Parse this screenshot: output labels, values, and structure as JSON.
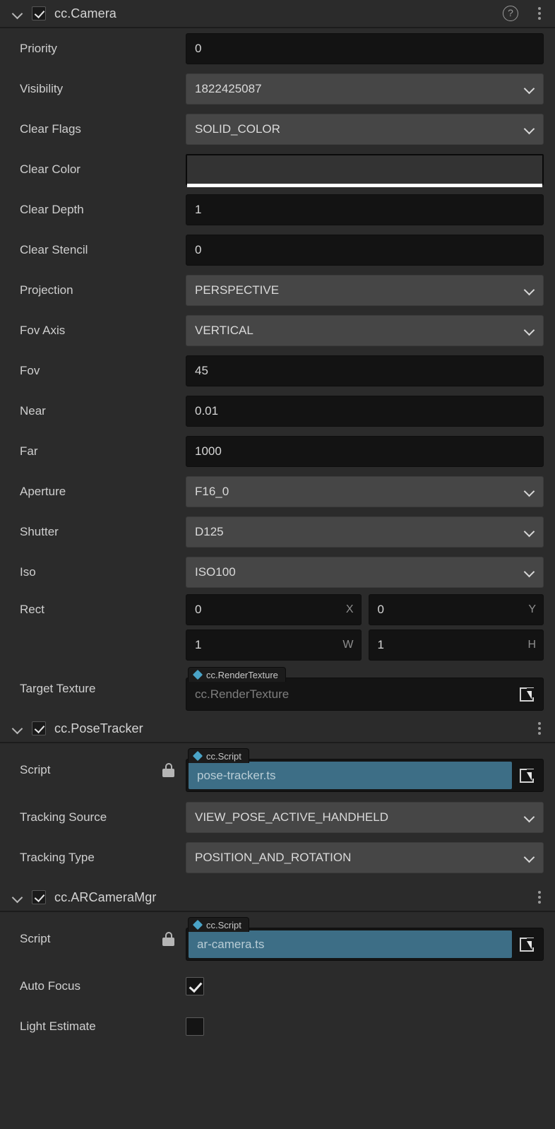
{
  "theme": {
    "panel_bg": "#2b2b2b",
    "input_bg": "#131313",
    "dropdown_bg": "#464646",
    "accent_asset": "#4aa3c7",
    "script_field_bg": "#3d6e86",
    "text": "#cccccc"
  },
  "components": [
    {
      "id": "camera",
      "title": "cc.Camera",
      "enabled": true,
      "expanded": true,
      "has_help": true,
      "has_menu": true,
      "help_icon": "question-circle-icon",
      "menu_icon": "kebab-menu-icon",
      "properties": [
        {
          "label": "Priority",
          "type": "number",
          "value": "0"
        },
        {
          "label": "Visibility",
          "type": "dropdown",
          "value": "1822425087"
        },
        {
          "label": "Clear Flags",
          "type": "dropdown",
          "value": "SOLID_COLOR"
        },
        {
          "label": "Clear Color",
          "type": "color",
          "value": "#333333",
          "alpha_bar": "#ffffff"
        },
        {
          "label": "Clear Depth",
          "type": "number",
          "value": "1"
        },
        {
          "label": "Clear Stencil",
          "type": "number",
          "value": "0"
        },
        {
          "label": "Projection",
          "type": "dropdown",
          "value": "PERSPECTIVE"
        },
        {
          "label": "Fov Axis",
          "type": "dropdown",
          "value": "VERTICAL"
        },
        {
          "label": "Fov",
          "type": "number",
          "value": "45"
        },
        {
          "label": "Near",
          "type": "number",
          "value": "0.01"
        },
        {
          "label": "Far",
          "type": "number",
          "value": "1000"
        },
        {
          "label": "Aperture",
          "type": "dropdown",
          "value": "F16_0"
        },
        {
          "label": "Shutter",
          "type": "dropdown",
          "value": "D125"
        },
        {
          "label": "Iso",
          "type": "dropdown",
          "value": "ISO100"
        }
      ],
      "rect": {
        "label": "Rect",
        "fields": [
          {
            "value": "0",
            "suffix": "X"
          },
          {
            "value": "0",
            "suffix": "Y"
          },
          {
            "value": "1",
            "suffix": "W"
          },
          {
            "value": "1",
            "suffix": "H"
          }
        ]
      },
      "target_texture": {
        "label": "Target Texture",
        "badge": "cc.RenderTexture",
        "badge_icon": "asset-diamond-icon",
        "value": "cc.RenderTexture",
        "is_placeholder": true,
        "pick_icon": "select-asset-icon"
      }
    },
    {
      "id": "pose-tracker",
      "title": "cc.PoseTracker",
      "enabled": true,
      "expanded": true,
      "has_help": false,
      "has_menu": true,
      "menu_icon": "kebab-menu-icon",
      "script": {
        "label": "Script",
        "locked": true,
        "lock_icon": "lock-icon",
        "badge": "cc.Script",
        "badge_icon": "asset-diamond-icon",
        "value": "pose-tracker.ts",
        "pick_icon": "select-asset-icon"
      },
      "properties": [
        {
          "label": "Tracking Source",
          "type": "dropdown",
          "value": "VIEW_POSE_ACTIVE_HANDHELD"
        },
        {
          "label": "Tracking Type",
          "type": "dropdown",
          "value": "POSITION_AND_ROTATION"
        }
      ]
    },
    {
      "id": "ar-camera-mgr",
      "title": "cc.ARCameraMgr",
      "enabled": true,
      "expanded": true,
      "has_help": false,
      "has_menu": true,
      "menu_icon": "kebab-menu-icon",
      "script": {
        "label": "Script",
        "locked": true,
        "lock_icon": "lock-icon",
        "badge": "cc.Script",
        "badge_icon": "asset-diamond-icon",
        "value": "ar-camera.ts",
        "pick_icon": "select-asset-icon"
      },
      "properties": [
        {
          "label": "Auto Focus",
          "type": "bool",
          "value": true
        },
        {
          "label": "Light Estimate",
          "type": "bool",
          "value": false
        }
      ]
    }
  ]
}
